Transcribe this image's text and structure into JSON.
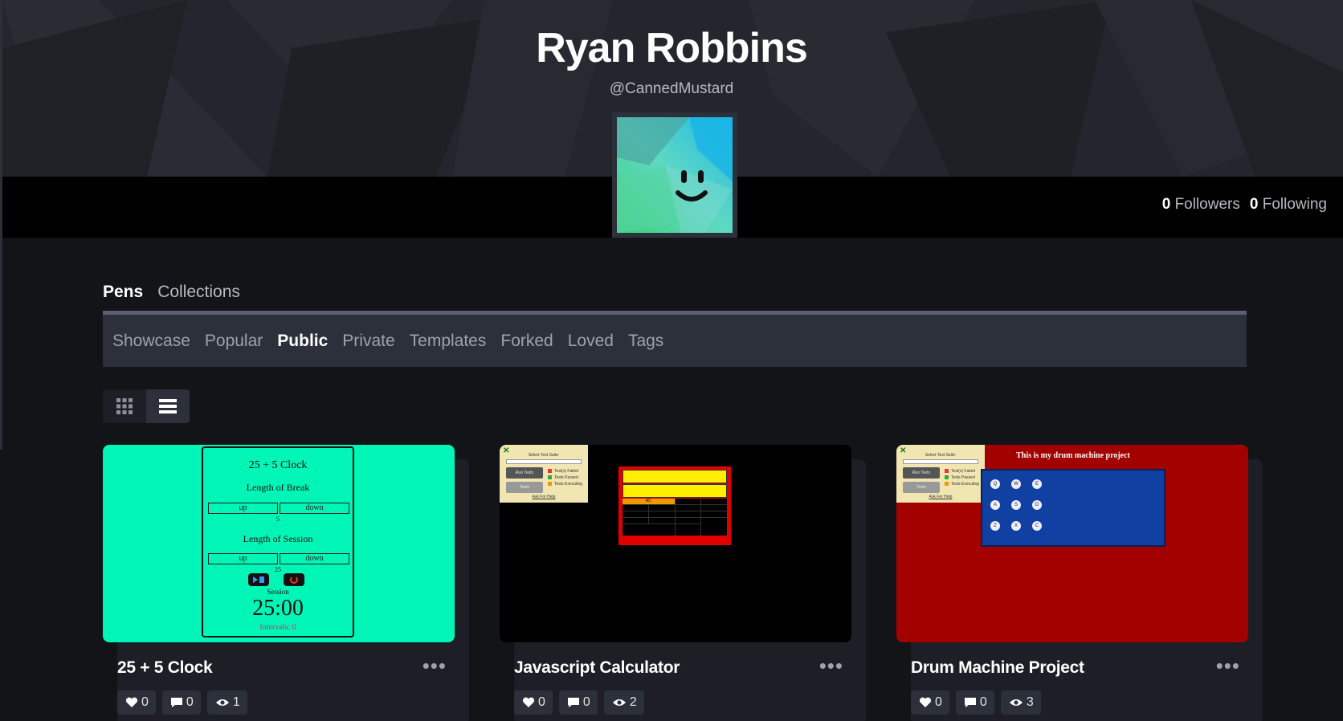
{
  "profile": {
    "name": "Ryan Robbins",
    "handle": "@CannedMustard",
    "followers_count": "0",
    "followers_label": "Followers",
    "following_count": "0",
    "following_label": "Following"
  },
  "tabs": [
    {
      "label": "Pens",
      "active": true
    },
    {
      "label": "Collections",
      "active": false
    }
  ],
  "subnav": [
    {
      "label": "Showcase"
    },
    {
      "label": "Popular"
    },
    {
      "label": "Public",
      "active": true
    },
    {
      "label": "Private"
    },
    {
      "label": "Templates"
    },
    {
      "label": "Forked"
    },
    {
      "label": "Loved"
    },
    {
      "label": "Tags"
    }
  ],
  "view_toggle": {
    "selected": "list",
    "icons": [
      "grid-icon",
      "list-icon"
    ]
  },
  "pens": [
    {
      "title": "25 + 5 Clock",
      "likes": "0",
      "comments": "0",
      "views": "1",
      "preview": {
        "heading": "25 + 5 Clock",
        "break_label": "Length of Break",
        "break_value": "5",
        "session_label": "Length of Session",
        "session_value": "25",
        "up": "up",
        "down": "down",
        "timer_label": "Session",
        "timer": "25:00",
        "intervals": "Intervals: 0",
        "bg": "#00f5b6"
      }
    },
    {
      "title": "Javascript Calculator",
      "likes": "0",
      "comments": "0",
      "views": "2",
      "preview": {
        "suite_title": "Select Test Suite:",
        "run_tests": "Run Tests",
        "tests": "Tests",
        "legend": [
          "Test(s) Failed",
          "Tests Passed",
          "Tests Executing"
        ],
        "help": "Ask For Help",
        "clear": "AC",
        "bg": "#000000"
      }
    },
    {
      "title": "Drum Machine Project",
      "likes": "0",
      "comments": "0",
      "views": "3",
      "preview": {
        "suite_title": "Select Test Suite:",
        "run_tests": "Run Tests",
        "tests": "Tests",
        "legend": [
          "Test(s) Failed",
          "Tests Passed",
          "Tests Executing"
        ],
        "help": "Ask For Help",
        "heading": "This is my drum machine project",
        "pads": [
          "Q",
          "W",
          "E",
          "A",
          "S",
          "D",
          "Z",
          "X",
          "C"
        ],
        "bg": "#a30000"
      }
    }
  ],
  "colors": {
    "page_bg": "#131417",
    "hero_bg": "#25262d",
    "panel": "#2c303a",
    "muted_text": "#b7b9c2"
  }
}
